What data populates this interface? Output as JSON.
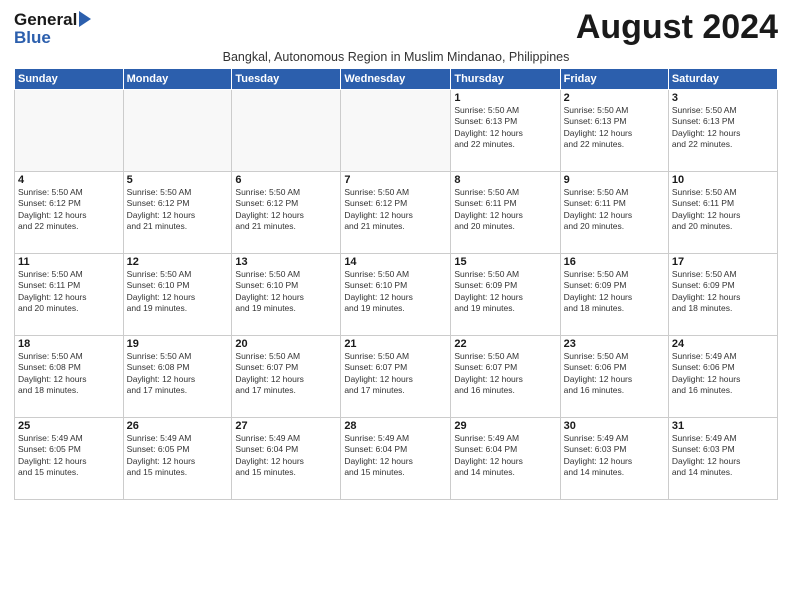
{
  "header": {
    "logo_general": "General",
    "logo_blue": "Blue",
    "month_title": "August 2024",
    "subtitle": "Bangkal, Autonomous Region in Muslim Mindanao, Philippines"
  },
  "days_of_week": [
    "Sunday",
    "Monday",
    "Tuesday",
    "Wednesday",
    "Thursday",
    "Friday",
    "Saturday"
  ],
  "weeks": [
    [
      {
        "day": "",
        "info": ""
      },
      {
        "day": "",
        "info": ""
      },
      {
        "day": "",
        "info": ""
      },
      {
        "day": "",
        "info": ""
      },
      {
        "day": "1",
        "info": "Sunrise: 5:50 AM\nSunset: 6:13 PM\nDaylight: 12 hours\nand 22 minutes."
      },
      {
        "day": "2",
        "info": "Sunrise: 5:50 AM\nSunset: 6:13 PM\nDaylight: 12 hours\nand 22 minutes."
      },
      {
        "day": "3",
        "info": "Sunrise: 5:50 AM\nSunset: 6:13 PM\nDaylight: 12 hours\nand 22 minutes."
      }
    ],
    [
      {
        "day": "4",
        "info": "Sunrise: 5:50 AM\nSunset: 6:12 PM\nDaylight: 12 hours\nand 22 minutes."
      },
      {
        "day": "5",
        "info": "Sunrise: 5:50 AM\nSunset: 6:12 PM\nDaylight: 12 hours\nand 21 minutes."
      },
      {
        "day": "6",
        "info": "Sunrise: 5:50 AM\nSunset: 6:12 PM\nDaylight: 12 hours\nand 21 minutes."
      },
      {
        "day": "7",
        "info": "Sunrise: 5:50 AM\nSunset: 6:12 PM\nDaylight: 12 hours\nand 21 minutes."
      },
      {
        "day": "8",
        "info": "Sunrise: 5:50 AM\nSunset: 6:11 PM\nDaylight: 12 hours\nand 20 minutes."
      },
      {
        "day": "9",
        "info": "Sunrise: 5:50 AM\nSunset: 6:11 PM\nDaylight: 12 hours\nand 20 minutes."
      },
      {
        "day": "10",
        "info": "Sunrise: 5:50 AM\nSunset: 6:11 PM\nDaylight: 12 hours\nand 20 minutes."
      }
    ],
    [
      {
        "day": "11",
        "info": "Sunrise: 5:50 AM\nSunset: 6:11 PM\nDaylight: 12 hours\nand 20 minutes."
      },
      {
        "day": "12",
        "info": "Sunrise: 5:50 AM\nSunset: 6:10 PM\nDaylight: 12 hours\nand 19 minutes."
      },
      {
        "day": "13",
        "info": "Sunrise: 5:50 AM\nSunset: 6:10 PM\nDaylight: 12 hours\nand 19 minutes."
      },
      {
        "day": "14",
        "info": "Sunrise: 5:50 AM\nSunset: 6:10 PM\nDaylight: 12 hours\nand 19 minutes."
      },
      {
        "day": "15",
        "info": "Sunrise: 5:50 AM\nSunset: 6:09 PM\nDaylight: 12 hours\nand 19 minutes."
      },
      {
        "day": "16",
        "info": "Sunrise: 5:50 AM\nSunset: 6:09 PM\nDaylight: 12 hours\nand 18 minutes."
      },
      {
        "day": "17",
        "info": "Sunrise: 5:50 AM\nSunset: 6:09 PM\nDaylight: 12 hours\nand 18 minutes."
      }
    ],
    [
      {
        "day": "18",
        "info": "Sunrise: 5:50 AM\nSunset: 6:08 PM\nDaylight: 12 hours\nand 18 minutes."
      },
      {
        "day": "19",
        "info": "Sunrise: 5:50 AM\nSunset: 6:08 PM\nDaylight: 12 hours\nand 17 minutes."
      },
      {
        "day": "20",
        "info": "Sunrise: 5:50 AM\nSunset: 6:07 PM\nDaylight: 12 hours\nand 17 minutes."
      },
      {
        "day": "21",
        "info": "Sunrise: 5:50 AM\nSunset: 6:07 PM\nDaylight: 12 hours\nand 17 minutes."
      },
      {
        "day": "22",
        "info": "Sunrise: 5:50 AM\nSunset: 6:07 PM\nDaylight: 12 hours\nand 16 minutes."
      },
      {
        "day": "23",
        "info": "Sunrise: 5:50 AM\nSunset: 6:06 PM\nDaylight: 12 hours\nand 16 minutes."
      },
      {
        "day": "24",
        "info": "Sunrise: 5:49 AM\nSunset: 6:06 PM\nDaylight: 12 hours\nand 16 minutes."
      }
    ],
    [
      {
        "day": "25",
        "info": "Sunrise: 5:49 AM\nSunset: 6:05 PM\nDaylight: 12 hours\nand 15 minutes."
      },
      {
        "day": "26",
        "info": "Sunrise: 5:49 AM\nSunset: 6:05 PM\nDaylight: 12 hours\nand 15 minutes."
      },
      {
        "day": "27",
        "info": "Sunrise: 5:49 AM\nSunset: 6:04 PM\nDaylight: 12 hours\nand 15 minutes."
      },
      {
        "day": "28",
        "info": "Sunrise: 5:49 AM\nSunset: 6:04 PM\nDaylight: 12 hours\nand 15 minutes."
      },
      {
        "day": "29",
        "info": "Sunrise: 5:49 AM\nSunset: 6:04 PM\nDaylight: 12 hours\nand 14 minutes."
      },
      {
        "day": "30",
        "info": "Sunrise: 5:49 AM\nSunset: 6:03 PM\nDaylight: 12 hours\nand 14 minutes."
      },
      {
        "day": "31",
        "info": "Sunrise: 5:49 AM\nSunset: 6:03 PM\nDaylight: 12 hours\nand 14 minutes."
      }
    ]
  ]
}
